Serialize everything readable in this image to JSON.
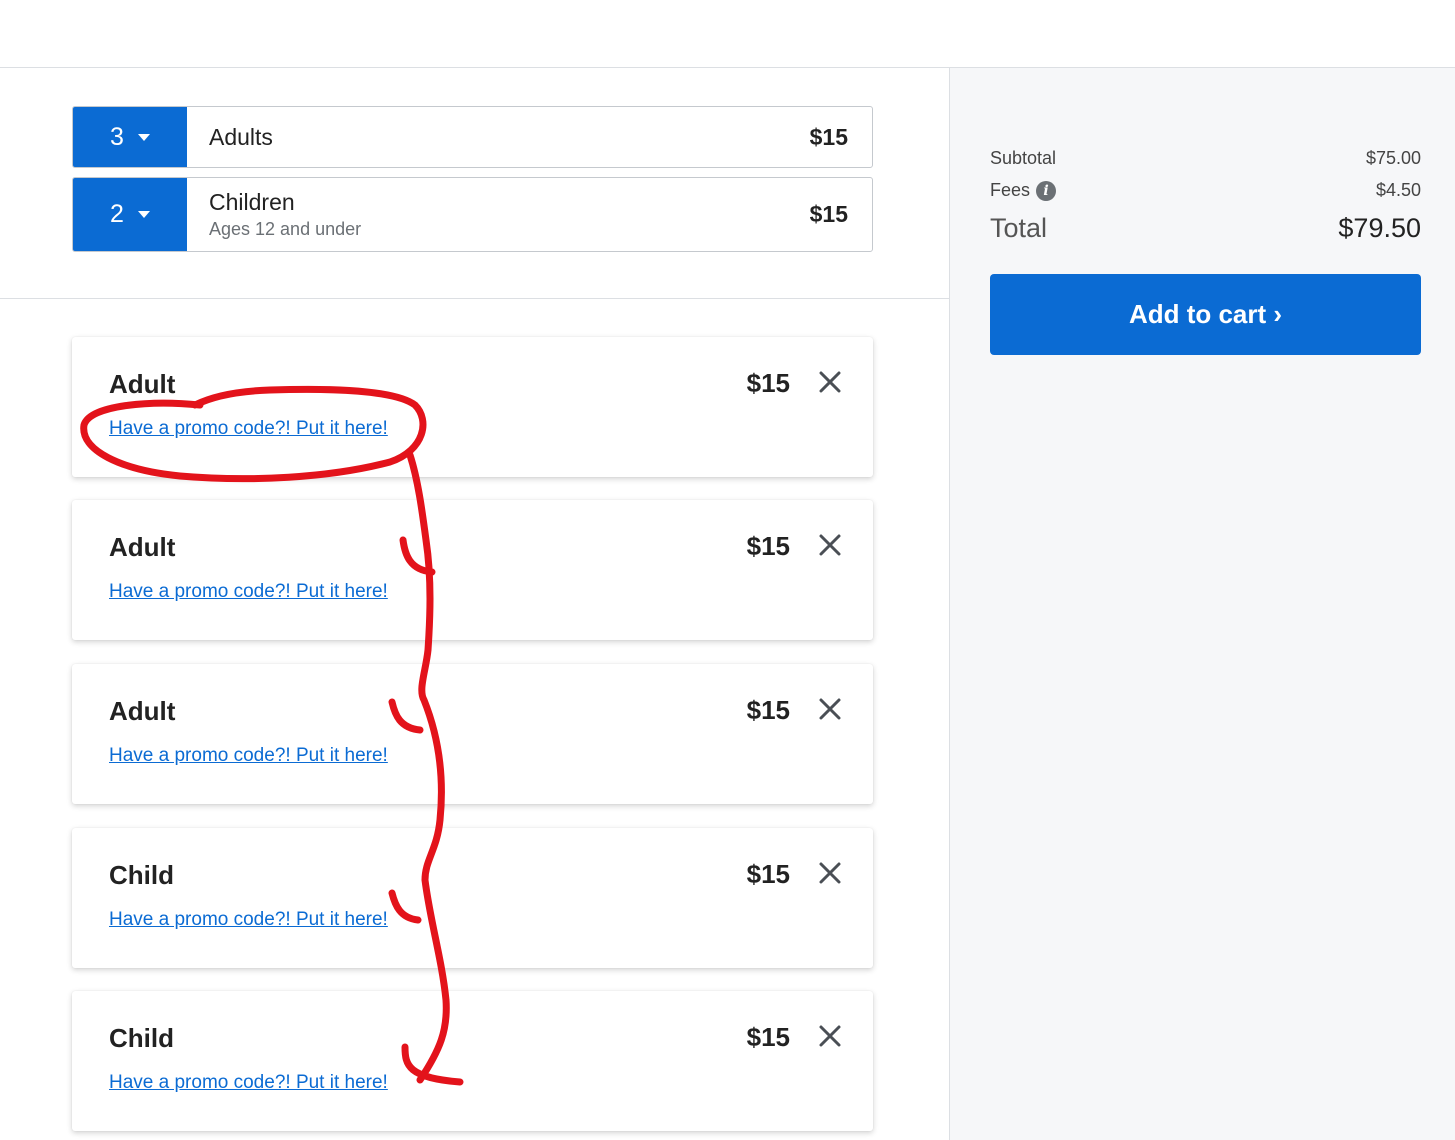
{
  "selectors": [
    {
      "qty": "3",
      "name": "Adults",
      "sub": "",
      "price": "$15"
    },
    {
      "qty": "2",
      "name": "Children",
      "sub": "Ages 12 and under",
      "price": "$15"
    }
  ],
  "tickets": [
    {
      "title": "Adult",
      "price": "$15",
      "promo_link": "Have a promo code?! Put it here!"
    },
    {
      "title": "Adult",
      "price": "$15",
      "promo_link": "Have a promo code?! Put it here!"
    },
    {
      "title": "Adult",
      "price": "$15",
      "promo_link": "Have a promo code?! Put it here!"
    },
    {
      "title": "Child",
      "price": "$15",
      "promo_link": "Have a promo code?! Put it here!"
    },
    {
      "title": "Child",
      "price": "$15",
      "promo_link": "Have a promo code?! Put it here!"
    }
  ],
  "summary": {
    "subtotal_label": "Subtotal",
    "subtotal_value": "$75.00",
    "fees_label": "Fees",
    "fees_value": "$4.50",
    "total_label": "Total",
    "total_value": "$79.50",
    "add_to_cart": "Add to cart ›"
  },
  "colors": {
    "accent": "#0b6bd3",
    "annotation": "#e3131b",
    "panel_bg": "#f6f7f9"
  },
  "icons": {
    "qty_caret": "caret-down-icon",
    "remove": "close-icon",
    "fees_info": "info-icon"
  }
}
